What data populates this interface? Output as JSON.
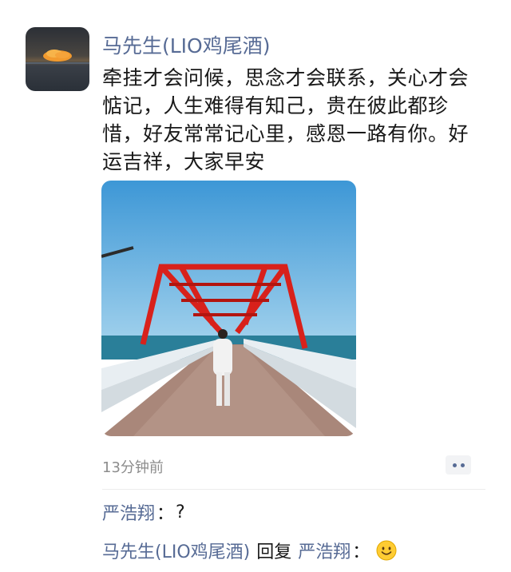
{
  "post": {
    "author": "马先生(LIO鸡尾酒)",
    "content": "牵挂才会问候，思念才会联系，关心才会惦记，人生难得有知己，贵在彼此都珍惜，好友常常记心里，感恩一路有你。好运吉祥，大家早安",
    "time": "13分钟前"
  },
  "comments": [
    {
      "author": "严浩翔",
      "separator": "：",
      "text": "?"
    },
    {
      "author": "马先生(LIO鸡尾酒)",
      "reply_word": "回复",
      "reply_to": "严浩翔",
      "separator": "：",
      "emoji": "smile-emoji"
    }
  ],
  "colors": {
    "name_link": "#576b95",
    "text": "#191919",
    "meta": "#8c8c8c"
  }
}
